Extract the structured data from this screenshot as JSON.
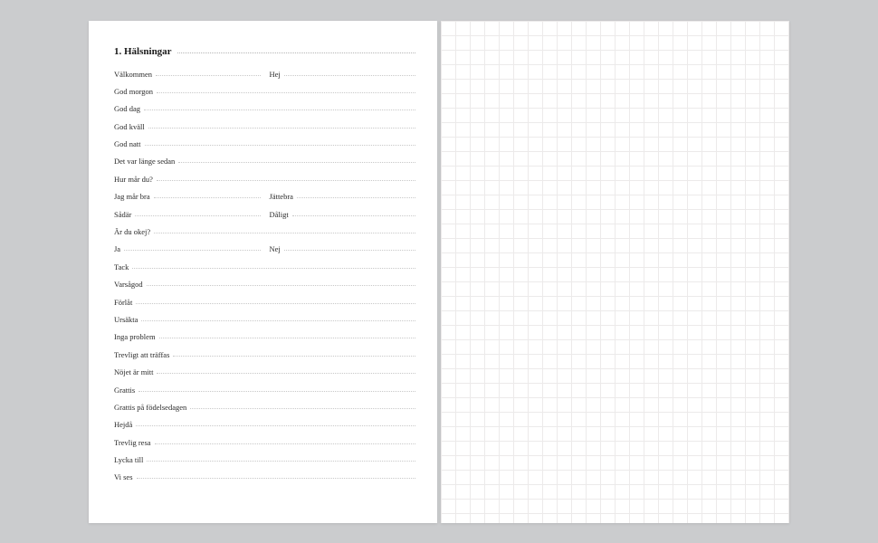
{
  "title": "1. Hälsningar",
  "rows": [
    {
      "type": "pair",
      "a": "Välkommen",
      "b": "Hej"
    },
    {
      "type": "single",
      "a": "God morgon"
    },
    {
      "type": "single",
      "a": "God dag"
    },
    {
      "type": "single",
      "a": "God kväll"
    },
    {
      "type": "single",
      "a": "God natt"
    },
    {
      "type": "single",
      "a": "Det var länge sedan"
    },
    {
      "type": "single",
      "a": "Hur mår du?"
    },
    {
      "type": "pair",
      "a": "Jag mår bra",
      "b": "Jättebra"
    },
    {
      "type": "pair",
      "a": "Sådär",
      "b": "Dåligt"
    },
    {
      "type": "single",
      "a": "Är du okej?"
    },
    {
      "type": "pair",
      "a": "Ja",
      "b": "Nej"
    },
    {
      "type": "single",
      "a": "Tack"
    },
    {
      "type": "single",
      "a": "Varsågod"
    },
    {
      "type": "single",
      "a": "Förlåt"
    },
    {
      "type": "single",
      "a": "Ursäkta"
    },
    {
      "type": "single",
      "a": "Inga problem"
    },
    {
      "type": "single",
      "a": "Trevligt att träffas"
    },
    {
      "type": "single",
      "a": "Nöjet är mitt"
    },
    {
      "type": "single",
      "a": "Grattis"
    },
    {
      "type": "single",
      "a": "Grattis på födelsedagen"
    },
    {
      "type": "single",
      "a": "Hejdå"
    },
    {
      "type": "single",
      "a": "Trevlig resa"
    },
    {
      "type": "single",
      "a": "Lycka till"
    },
    {
      "type": "single",
      "a": "Vi ses"
    }
  ]
}
